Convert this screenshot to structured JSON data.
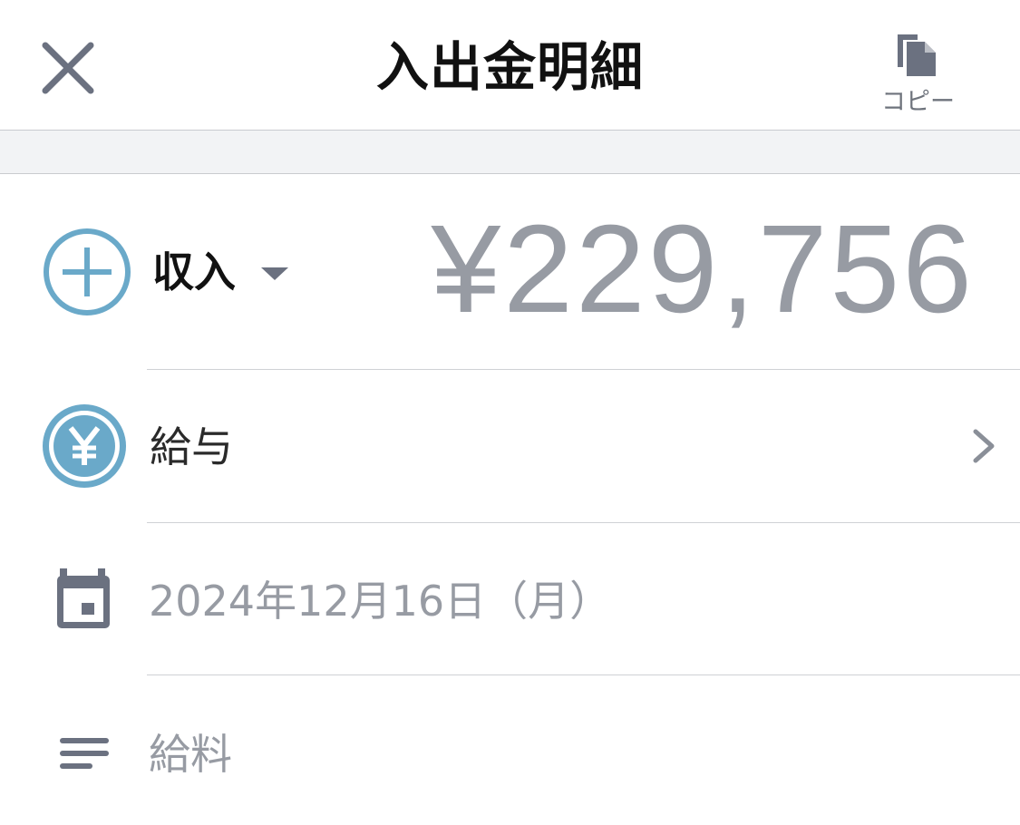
{
  "header": {
    "title": "入出金明細",
    "close_icon": "close-icon",
    "copy_icon": "copy-icon",
    "copy_label": "コピー"
  },
  "transaction": {
    "type_label": "収入",
    "type_icon": "plus-circle-icon",
    "amount": "¥229,756"
  },
  "category": {
    "icon": "yen-circle-icon",
    "label": "給与"
  },
  "date": {
    "icon": "calendar-icon",
    "value": "2024年12月16日（月）"
  },
  "memo": {
    "icon": "memo-lines-icon",
    "value": "給料"
  },
  "colors": {
    "accent_blue": "#6aa9c9",
    "muted_text": "#979ba3",
    "icon_gray": "#6b7180",
    "band_gray": "#f2f3f5"
  }
}
